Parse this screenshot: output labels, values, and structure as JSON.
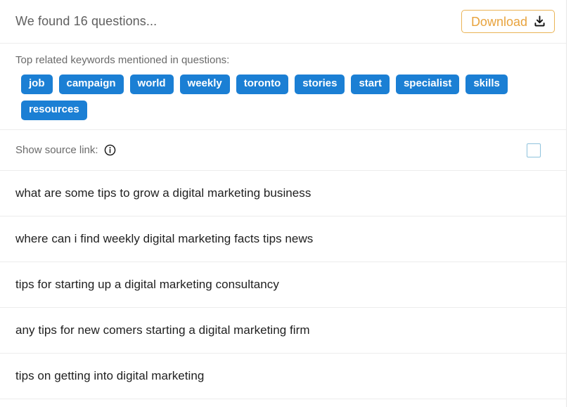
{
  "header": {
    "found_text": "We found 16 questions...",
    "download_label": "Download",
    "download_icon": "download-icon",
    "accent_orange": "#e8a33d",
    "border_orange": "#eab456"
  },
  "keywords": {
    "title": "Top related keywords mentioned in questions:",
    "tag_color": "#1b7fd4",
    "tag_text_color": "#ffffff",
    "tags": [
      {
        "label": "job"
      },
      {
        "label": "campaign"
      },
      {
        "label": "world"
      },
      {
        "label": "weekly"
      },
      {
        "label": "toronto"
      },
      {
        "label": "stories"
      },
      {
        "label": "start"
      },
      {
        "label": "specialist"
      },
      {
        "label": "skills"
      },
      {
        "label": "resources"
      }
    ]
  },
  "source_link": {
    "label": "Show source link:",
    "info_icon": "info-circle-icon",
    "checkbox_checked": false,
    "checkbox_border_color": "#8fc3dd"
  },
  "questions": [
    {
      "text": "what are some tips to grow a digital marketing business"
    },
    {
      "text": "where can i find weekly digital marketing facts tips news"
    },
    {
      "text": "tips for starting up a digital marketing consultancy"
    },
    {
      "text": "any tips for new comers starting a digital marketing firm"
    },
    {
      "text": "tips on getting into digital marketing"
    }
  ]
}
